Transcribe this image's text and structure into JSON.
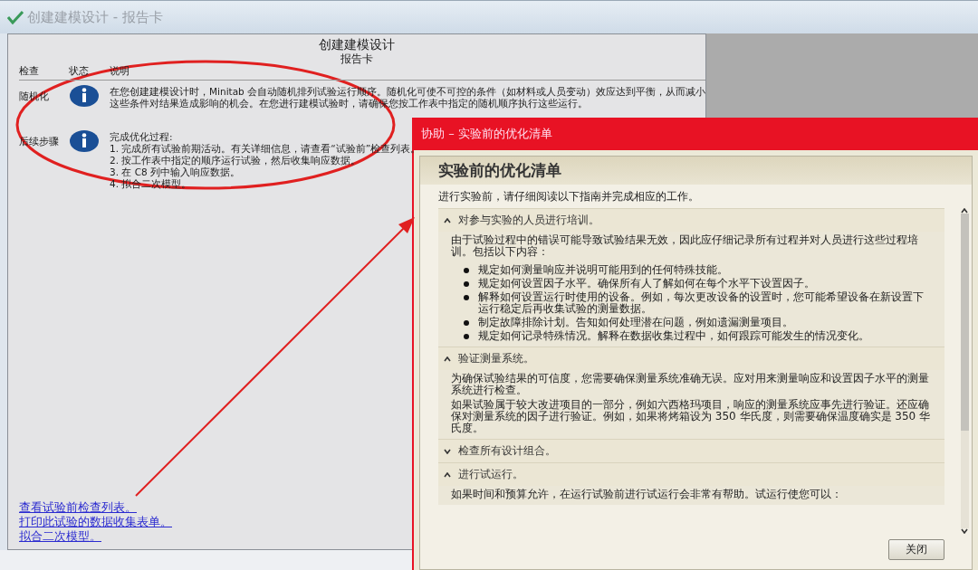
{
  "window": {
    "title": "创建建模设计 - 报告卡"
  },
  "report": {
    "title": "创建建模设计",
    "subtitle": "报告卡",
    "columns": [
      "检查",
      "状态",
      "说明"
    ],
    "rows": [
      {
        "check": "随机化",
        "kind": "info",
        "lines": [
          "在您创建建模设计时，Minitab 会自动随机排列试验运行顺序。随机化可使不可控的条件（如材料或人员变动）效应达到平衡，从而减小",
          "这些条件对结果造成影响的机会。在您进行建模试验时，请确保您按工作表中指定的随机顺序执行这些运行。"
        ]
      },
      {
        "check": "后续步骤",
        "kind": "info",
        "lines": [
          "完成优化过程:",
          "1. 完成所有试验前期活动。有关详细信息，请查看“试验前”检查列表。",
          "2. 按工作表中指定的顺序运行试验，然后收集响应数据。",
          "3. 在 C8 列中输入响应数据。",
          "4. 拟合二次模型。"
        ]
      }
    ],
    "links": [
      "查看试验前检查列表。",
      "打印此试验的数据收集表单。",
      "拟合二次模型。"
    ]
  },
  "help": {
    "title": "协助 – 实验前的优化清单",
    "heading": "实验前的优化清单",
    "intro": "进行实验前，请仔细阅读以下指南并完成相应的工作。",
    "sections": [
      {
        "title": "对参与实验的人员进行培训。",
        "expanded": true,
        "paragraphs": [
          "由于试验过程中的错误可能导致试验结果无效，因此应仔细记录所有过程并对人员进行这些过程培训。包括以下内容："
        ],
        "bullets": [
          "规定如何测量响应并说明可能用到的任何特殊技能。",
          "规定如何设置因子水平。确保所有人了解如何在每个水平下设置因子。",
          "解释如何设置运行时使用的设备。例如，每次更改设备的设置时，您可能希望设备在新设置下运行稳定后再收集试验的测量数据。",
          "制定故障排除计划。告知如何处理潜在问题，例如遗漏测量项目。",
          "规定如何记录特殊情况。解释在数据收集过程中，如何跟踪可能发生的情况变化。"
        ]
      },
      {
        "title": "验证测量系统。",
        "expanded": true,
        "paragraphs": [
          "为确保试验结果的可信度，您需要确保测量系统准确无误。应对用来测量响应和设置因子水平的测量系统进行检查。",
          "如果试验属于较大改进项目的一部分，例如六西格玛项目，响应的测量系统应事先进行验证。还应确保对测量系统的因子进行验证。例如，如果将烤箱设为 350 华氏度，则需要确保温度确实是 350 华氏度。"
        ]
      },
      {
        "title": "检查所有设计组合。",
        "expanded": false
      },
      {
        "title": "进行试运行。",
        "expanded": true,
        "paragraphs": [
          "如果时间和预算允许，在运行试验前进行试运行会非常有帮助。试运行使您可以："
        ]
      }
    ],
    "close_button": "关闭"
  }
}
